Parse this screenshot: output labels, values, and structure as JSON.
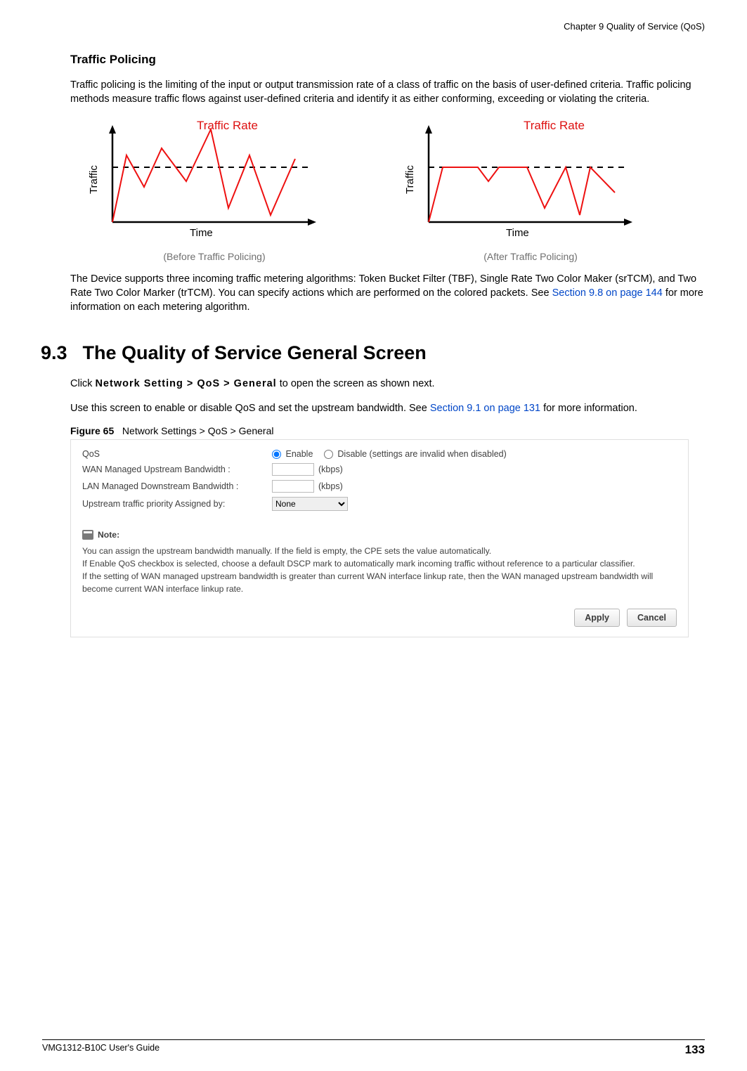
{
  "header": {
    "chapter": "Chapter 9 Quality of Service (QoS)"
  },
  "sec_tp": {
    "title": "Traffic Policing",
    "p1": "Traffic policing is the limiting of the input or output transmission rate of a class of traffic on the basis of user-defined criteria. Traffic policing methods measure traffic flows against user-defined criteria and identify it as either conforming, exceeding or violating the criteria.",
    "p2a": "The Device supports three incoming traffic metering algorithms: Token Bucket Filter (TBF), Single Rate Two Color Maker (srTCM), and Two Rate Two Color Marker (trTCM). You can specify actions which are performed on the colored packets. See ",
    "p2link": "Section 9.8 on page 144",
    "p2b": " for more information on each metering algorithm."
  },
  "chart_labels": {
    "y": "Traffic",
    "x": "Time",
    "rate": "Traffic Rate",
    "cap_before": "(Before Traffic Policing)",
    "cap_after": "(After Traffic Policing)"
  },
  "chart_data": [
    {
      "type": "line",
      "title": "Before Traffic Policing",
      "xlabel": "Time",
      "ylabel": "Traffic",
      "threshold": 60,
      "threshold_label": "Traffic Rate",
      "x": [
        0,
        20,
        45,
        70,
        105,
        140,
        165,
        195,
        225,
        260
      ],
      "values": [
        0,
        72,
        40,
        85,
        47,
        105,
        22,
        78,
        12,
        70
      ],
      "xlim": [
        0,
        280
      ],
      "ylim": [
        0,
        110
      ]
    },
    {
      "type": "line",
      "title": "After Traffic Policing",
      "xlabel": "Time",
      "ylabel": "Traffic",
      "threshold": 60,
      "threshold_label": "Traffic Rate",
      "x": [
        0,
        20,
        45,
        70,
        85,
        100,
        115,
        140,
        165,
        195,
        215,
        230,
        265
      ],
      "values": [
        0,
        60,
        60,
        60,
        47,
        60,
        60,
        60,
        22,
        60,
        12,
        60,
        38
      ],
      "xlim": [
        0,
        280
      ],
      "ylim": [
        0,
        110
      ]
    }
  ],
  "sec93": {
    "num": "9.3",
    "title": "The Quality of Service General Screen",
    "p1a": "Click ",
    "p1nav": "Network Setting > QoS > General",
    "p1b": " to open the screen as shown next.",
    "p2a": "Use this screen to enable or disable QoS and set the upstream bandwidth. See ",
    "p2link": "Section 9.1 on page 131",
    "p2b": " for more information."
  },
  "figure": {
    "num": "Figure 65",
    "caption": "Network Settings > QoS > General"
  },
  "form": {
    "qos_label": "QoS",
    "enable": "Enable",
    "disable": "Disable (settings are invalid when disabled)",
    "wan_label": "WAN Managed Upstream Bandwidth :",
    "lan_label": "LAN Managed Downstream Bandwidth :",
    "kbps": "(kbps)",
    "prio_label": "Upstream traffic priority Assigned by:",
    "prio_value": "None",
    "note_head": "Note:",
    "note1": "You can assign the upstream bandwidth manually. If the field is empty, the CPE sets the value automatically.",
    "note2": "If Enable QoS checkbox is selected, choose a default DSCP mark to automatically mark incoming traffic without reference to a particular classifier.",
    "note3": "If the setting of WAN managed upstream bandwidth is greater than current WAN interface linkup rate, then the WAN managed upstream bandwidth will become current WAN interface linkup rate.",
    "apply": "Apply",
    "cancel": "Cancel"
  },
  "footer": {
    "guide": "VMG1312-B10C User's Guide",
    "page": "133"
  }
}
